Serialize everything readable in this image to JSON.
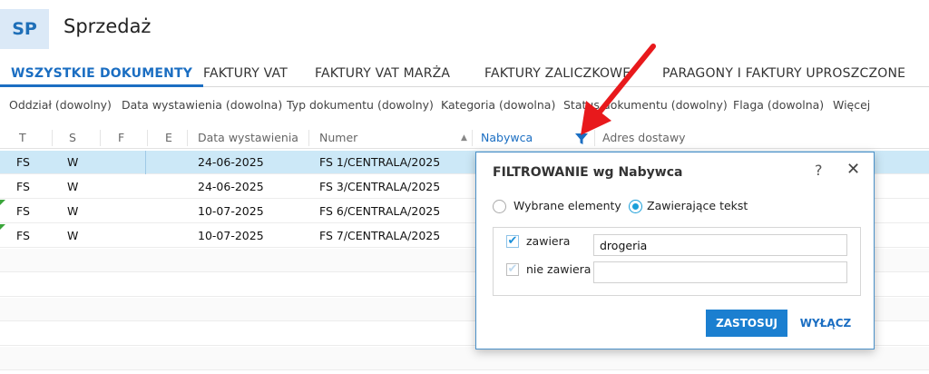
{
  "app": {
    "badge": "SP",
    "title": "Sprzedaż"
  },
  "tabs": [
    "WSZYSTKIE DOKUMENTY",
    "FAKTURY VAT",
    "FAKTURY VAT MARŻA",
    "FAKTURY ZALICZKOWE",
    "PARAGONY I FAKTURY UPROSZCZONE"
  ],
  "filters": [
    "Oddział (dowolny)",
    "Data wystawienia (dowolna)",
    "Typ dokumentu (dowolny)",
    "Kategoria (dowolna)",
    "Status dokumentu (dowolny)",
    "Flaga (dowolna)",
    "Więcej"
  ],
  "columns": [
    "T",
    "S",
    "F",
    "E",
    "Data wystawienia",
    "Numer",
    "Nabywca",
    "Adres dostawy"
  ],
  "rows": [
    {
      "t": "FS",
      "s": "W",
      "date": "24-06-2025",
      "number": "FS 1/CENTRALA/2025"
    },
    {
      "t": "FS",
      "s": "W",
      "date": "24-06-2025",
      "number": "FS 3/CENTRALA/2025"
    },
    {
      "t": "FS",
      "s": "W",
      "date": "10-07-2025",
      "number": "FS 6/CENTRALA/2025"
    },
    {
      "t": "FS",
      "s": "W",
      "date": "10-07-2025",
      "number": "FS 7/CENTRALA/2025"
    }
  ],
  "dialog": {
    "title": "FILTROWANIE wg  Nabywca",
    "help": "?",
    "close": "✕",
    "radio_selected_items": "Wybrane elementy",
    "radio_contains_text": "Zawierające tekst",
    "contains_label": "zawiera",
    "contains_value": "drogeria",
    "not_contains_label": "nie zawiera",
    "not_contains_value": "",
    "apply": "ZASTOSUJ",
    "disable": "WYŁĄCZ"
  },
  "colors": {
    "accent": "#1b6ec2",
    "selected_row": "#cce8f7",
    "arrow": "#e8191c"
  }
}
